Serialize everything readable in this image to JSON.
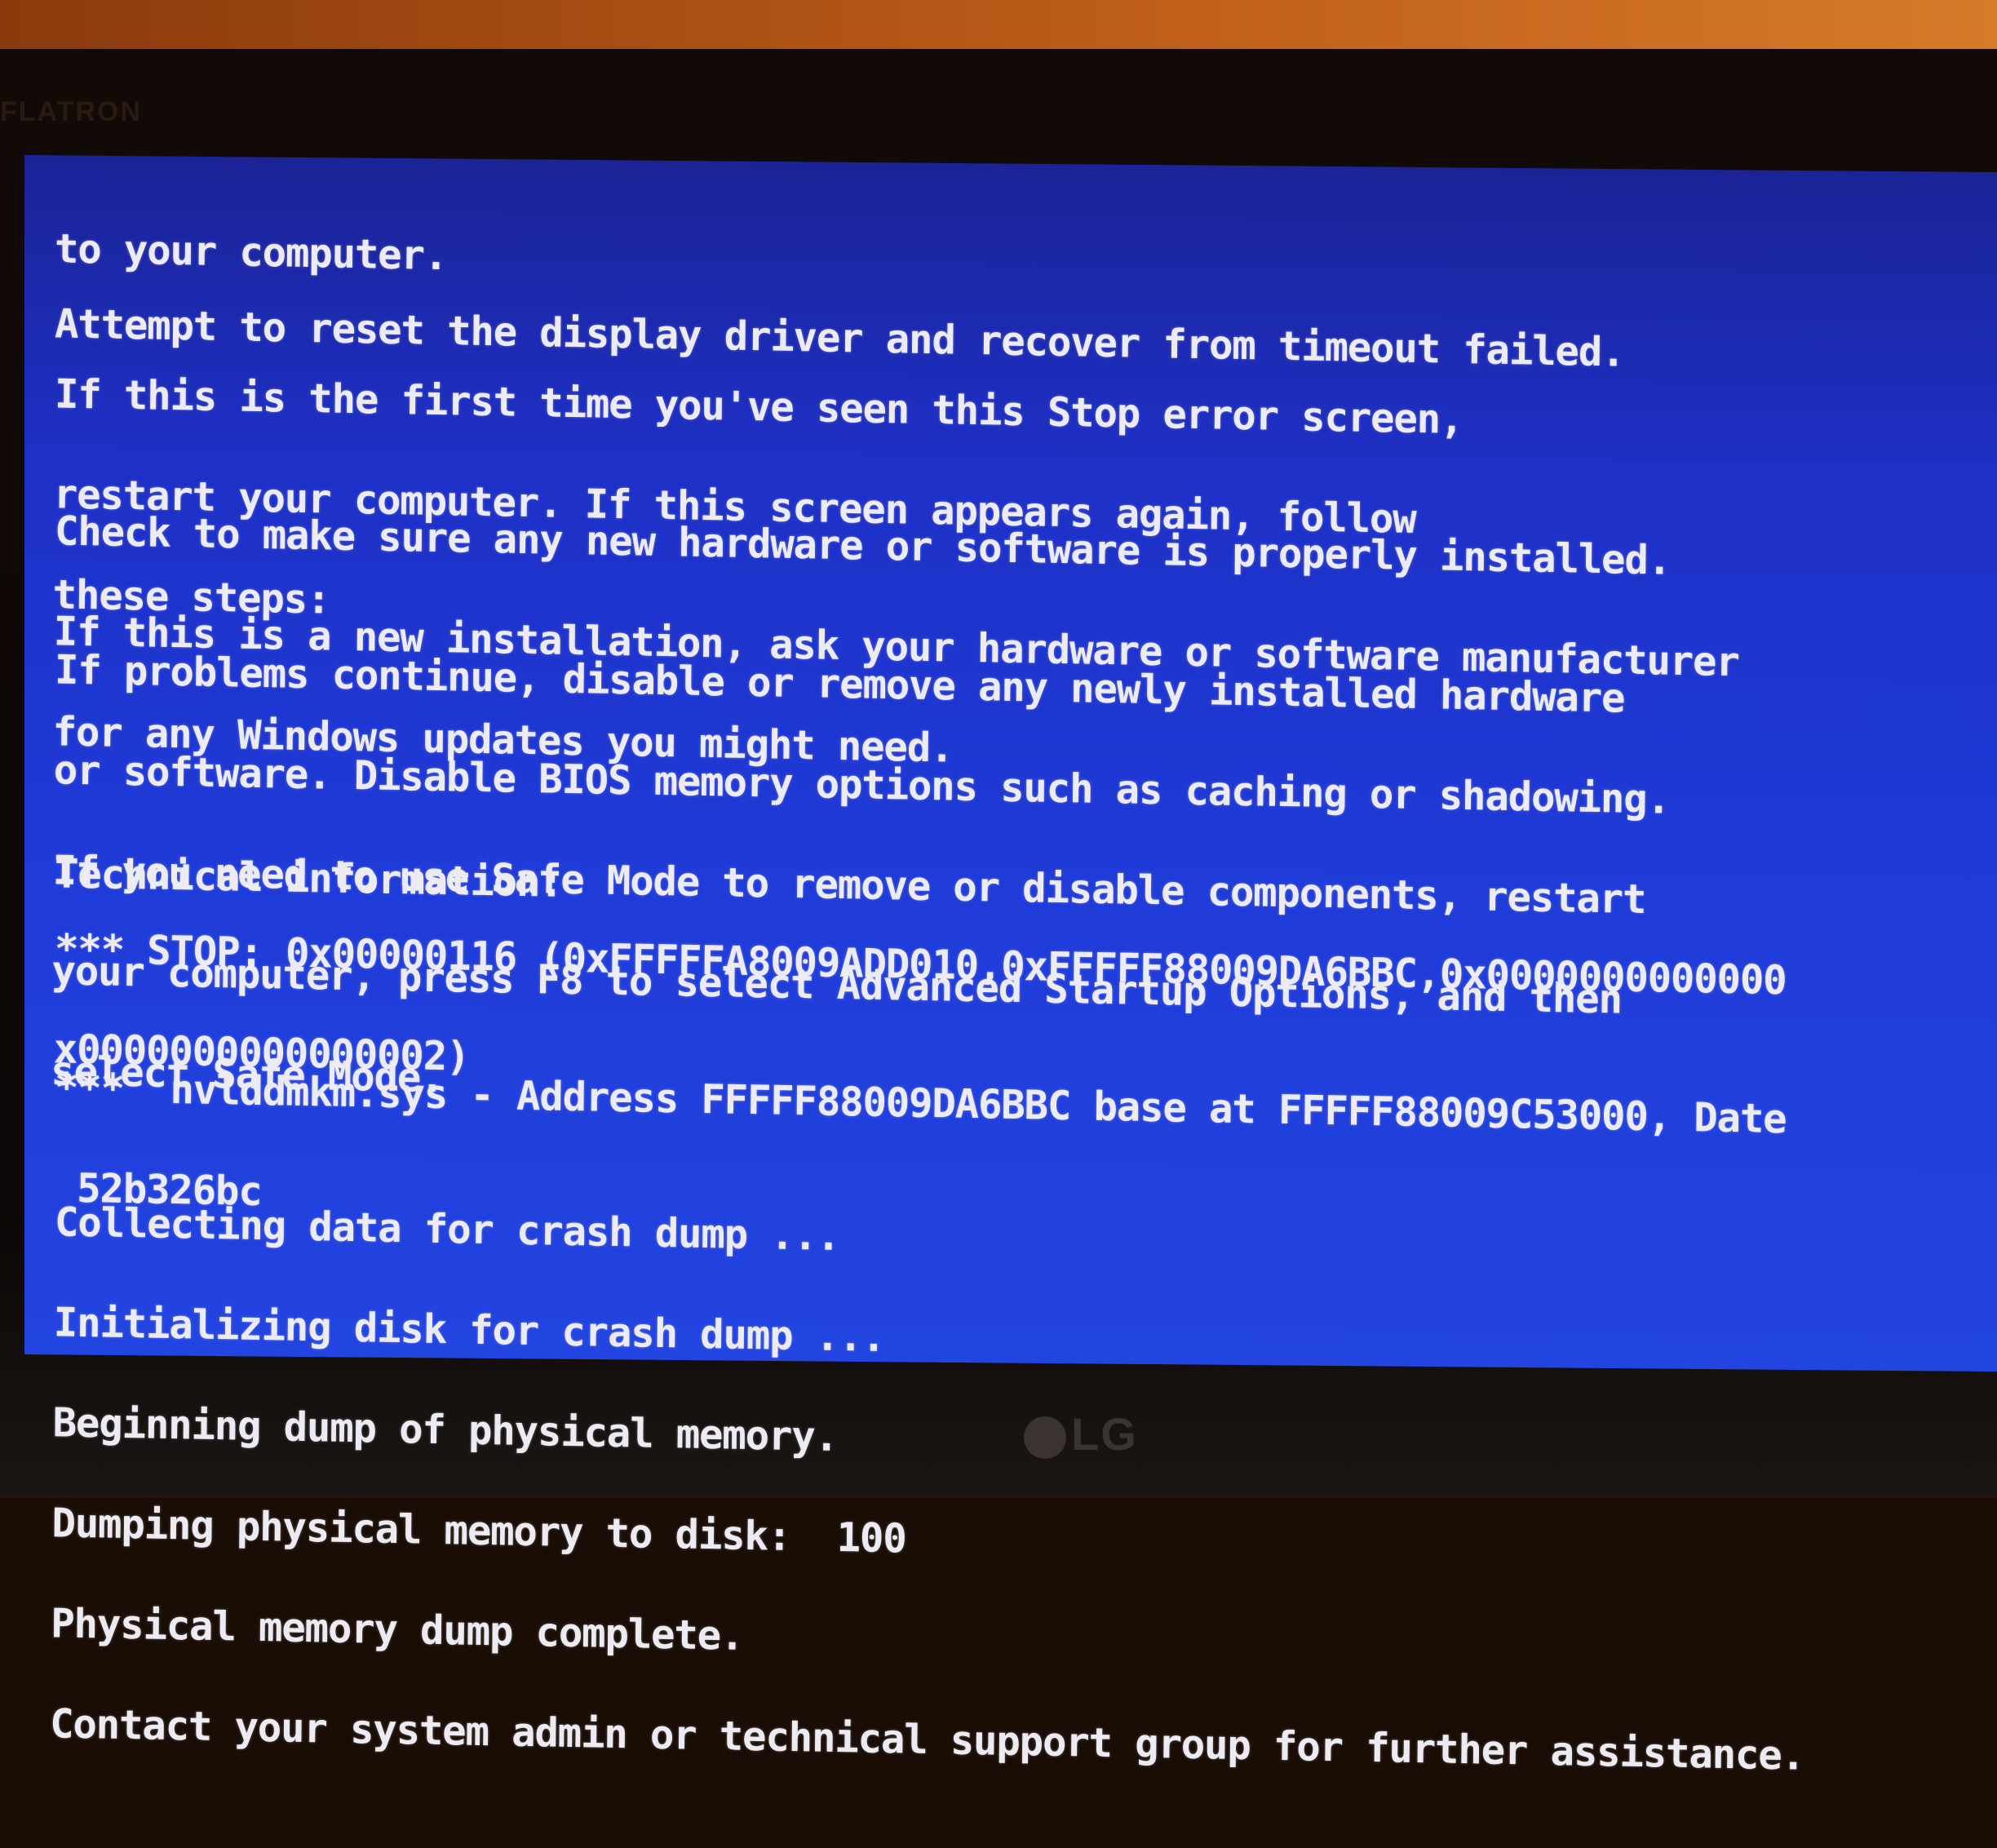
{
  "monitor": {
    "brand_top": "FLATRON",
    "brand_bottom": "LG"
  },
  "screen": {
    "background_color": "#1f3bd8",
    "text_color": "#ecebf4",
    "paragraphs": [
      [
        "to your computer."
      ],
      [
        "Attempt to reset the display driver and recover from timeout failed."
      ],
      [
        "If this is the first time you've seen this Stop error screen,",
        "restart your computer. If this screen appears again, follow",
        "these steps:"
      ],
      [
        "Check to make sure any new hardware or software is properly installed.",
        "If this is a new installation, ask your hardware or software manufacturer",
        "for any Windows updates you might need."
      ],
      [
        "If problems continue, disable or remove any newly installed hardware",
        "or software. Disable BIOS memory options such as caching or shadowing.",
        "If you need to use Safe Mode to remove or disable components, restart",
        "your computer, press F8 to select Advanced Startup Options, and then",
        "select Safe Mode."
      ],
      [
        "Technical information:"
      ],
      [
        "*** STOP: 0x00000116 (0xFFFFFA8009ADD010,0xFFFFF88009DA6BBC,0x0000000000000",
        "x0000000000000002)"
      ],
      [
        "***  nvlddmkm.sys - Address FFFFF88009DA6BBC base at FFFFF88009C53000, Date",
        " 52b326bc"
      ],
      [
        "Collecting data for crash dump ...",
        "Initializing disk for crash dump ...",
        "Beginning dump of physical memory.",
        "Dumping physical memory to disk:  100",
        "Physical memory dump complete.",
        "Contact your system admin or technical support group for further assistance."
      ]
    ]
  }
}
